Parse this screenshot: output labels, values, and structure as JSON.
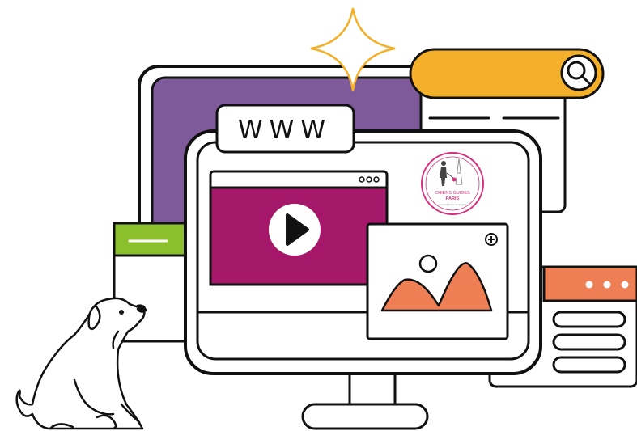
{
  "address_bar": {
    "text": "WWW"
  },
  "logo": {
    "line1": "CHIENS GUIDES",
    "line2": "PARIS",
    "tagline": "promenades & compagnie"
  },
  "colors": {
    "outline": "#111111",
    "purple": "#7f5a9a",
    "magenta": "#a51769",
    "orange": "#f4b02a",
    "coral": "#ee7f54",
    "green": "#8bbf2c",
    "pink": "#d6317f"
  },
  "icons": {
    "search": "search-icon",
    "play": "play-icon",
    "plus": "plus-circle-icon",
    "sparkle": "sparkle-icon",
    "dots": "more-dots-icon"
  }
}
